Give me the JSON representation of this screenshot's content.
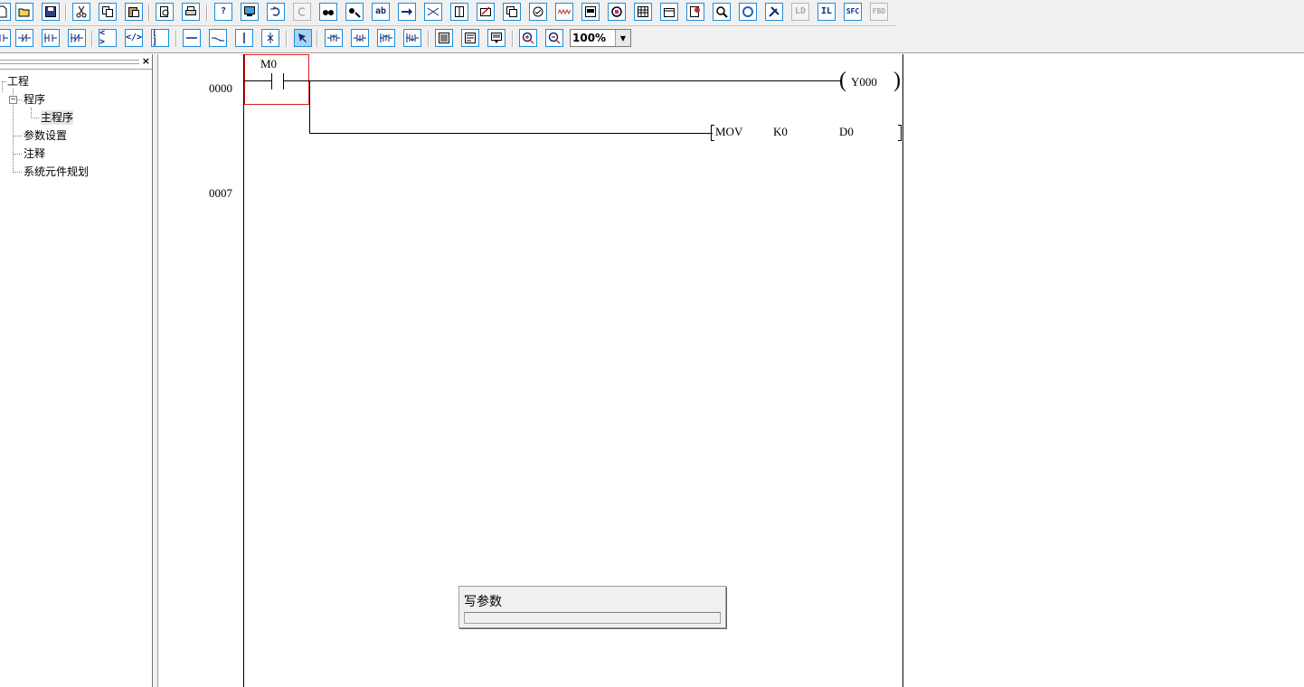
{
  "toolbar_row1": {
    "buttons": [
      {
        "icon": "new-file-icon"
      },
      {
        "icon": "open-folder-icon"
      },
      {
        "icon": "save-icon"
      },
      {
        "icon": "cut-icon"
      },
      {
        "icon": "copy-icon"
      },
      {
        "icon": "paste-icon"
      },
      {
        "icon": "print-preview-icon"
      },
      {
        "icon": "print-icon"
      },
      {
        "icon": "help-icon"
      },
      {
        "icon": "pc-monitor-icon"
      },
      {
        "icon": "undo-icon"
      },
      {
        "icon": "redo-icon"
      },
      {
        "icon": "find-icon"
      },
      {
        "icon": "find-replace-icon"
      },
      {
        "icon": "abc-sort-icon"
      },
      {
        "icon": "jump-arrow-icon"
      },
      {
        "icon": "transfer-icon"
      },
      {
        "icon": "book-icon"
      },
      {
        "icon": "write-plc-icon"
      },
      {
        "icon": "read-plc-icon"
      },
      {
        "icon": "verify-icon"
      },
      {
        "icon": "waveform-icon"
      },
      {
        "icon": "monitor-window-icon"
      },
      {
        "icon": "device-monitor-icon"
      },
      {
        "icon": "table-icon"
      },
      {
        "icon": "calendar-icon"
      },
      {
        "icon": "diagnose-icon"
      },
      {
        "icon": "zoom-search-icon"
      },
      {
        "icon": "refresh-icon"
      },
      {
        "icon": "tools-icon"
      }
    ],
    "mode_buttons": [
      {
        "label": "LD",
        "state": "disabled"
      },
      {
        "label": "IL",
        "state": "enabled"
      },
      {
        "label": "SFC",
        "state": "enabled"
      },
      {
        "label": "FBD",
        "state": "disabled"
      }
    ]
  },
  "toolbar_row2": {
    "buttons": [
      {
        "icon": "no-contact-icon"
      },
      {
        "icon": "nc-contact-icon"
      },
      {
        "icon": "parallel-no-icon"
      },
      {
        "icon": "parallel-nc-icon"
      },
      {
        "icon": "coil-icon"
      },
      {
        "icon": "nc-coil-icon"
      },
      {
        "icon": "application-instruction-icon"
      },
      {
        "icon": "horizontal-line-icon"
      },
      {
        "icon": "diagonal-line-icon"
      },
      {
        "icon": "vertical-line-icon"
      },
      {
        "icon": "delete-line-icon"
      },
      {
        "icon": "select-cursor-icon"
      },
      {
        "icon": "rising-edge-icon"
      },
      {
        "icon": "falling-edge-icon"
      },
      {
        "icon": "parallel-rising-icon"
      },
      {
        "icon": "parallel-falling-icon"
      },
      {
        "icon": "comment-display-icon"
      },
      {
        "icon": "statement-display-icon"
      },
      {
        "icon": "note-display-icon"
      },
      {
        "icon": "zoom-in-icon"
      },
      {
        "icon": "zoom-out-icon"
      }
    ],
    "zoom": "100%"
  },
  "project_tree": {
    "root": "工程",
    "program": "程序",
    "main_program": "主程序",
    "parameters": "参数设置",
    "comments": "注释",
    "device_plan": "系统元件规划",
    "close_symbol": "×"
  },
  "ladder": {
    "steps": [
      "0000",
      "0007"
    ],
    "contact_device": "M0",
    "coil_device": "Y000",
    "instruction": {
      "op": "MOV",
      "src": "K0",
      "dst": "D0"
    }
  },
  "progress_dialog": {
    "title": "写参数",
    "progress": 0
  }
}
